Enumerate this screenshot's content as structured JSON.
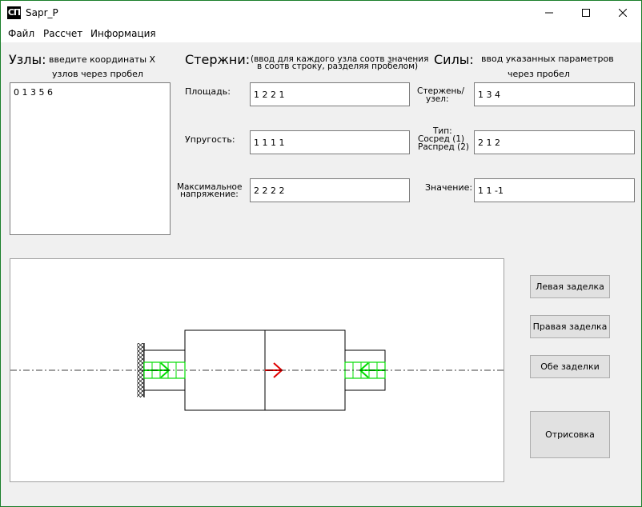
{
  "window": {
    "title": "Sapr_P",
    "icon_text": "СП",
    "border_color": "#1a7f2a"
  },
  "menu": {
    "file": "Файл",
    "calc": "Рассчет",
    "info": "Информация"
  },
  "nodes": {
    "heading": "Узлы:",
    "hint_line1": "введите координаты X",
    "hint_line2": "узлов через пробел",
    "value": "0 1 3 5 6"
  },
  "rods": {
    "heading": "Стержни:",
    "hint_line1": "(ввод для каждого узла соотв значения",
    "hint_line2": "в соотв строку, разделяя пробелом)",
    "area_label": "Площадь:",
    "area_value": "1 2 2 1",
    "elasticity_label": "Упругость:",
    "elasticity_value": "1 1 1 1",
    "max_stress_label1": "Максимальное",
    "max_stress_label2": "напряжение:",
    "max_stress_value": "2 2 2 2"
  },
  "forces": {
    "heading": "Силы:",
    "hint_line1": "ввод указанных параметров",
    "hint_line2": "через пробел",
    "rod_node_label1": "Стержень/",
    "rod_node_label2": "узел:",
    "rod_node_value": "1 3 4",
    "type_label1": "Тип:",
    "type_label2": "Сосред (1)",
    "type_label3": "Распред (2)",
    "type_value": "2 1 2",
    "value_label": "Значение:",
    "value_value": "1 1 -1"
  },
  "buttons": {
    "left_support": "Левая заделка",
    "right_support": "Правая заделка",
    "both_supports": "Обе заделки",
    "draw": "Отрисовка"
  },
  "colors": {
    "distributed_load": "#00dd00",
    "point_force": "#e00000"
  }
}
